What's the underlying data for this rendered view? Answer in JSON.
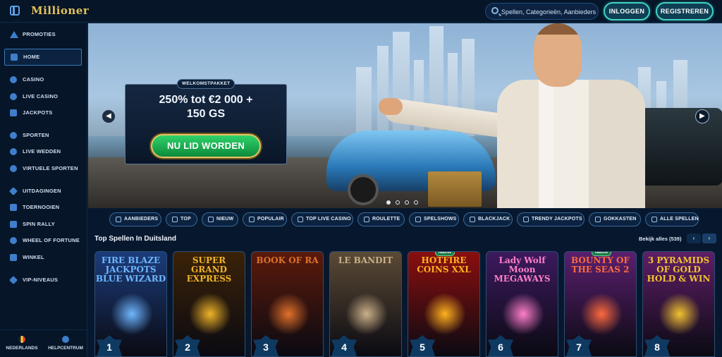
{
  "header": {
    "logo": "Millioner",
    "search_placeholder": "Spellen, Categorieën, Aanbieders",
    "login_label": "INLOGGEN",
    "register_label": "REGISTREREN"
  },
  "sidebar": {
    "items": [
      {
        "label": "PROMOTIES",
        "icon": "megaphone-icon"
      },
      {
        "label": "HOME",
        "icon": "home-icon",
        "active": true
      },
      {
        "label": "CASINO",
        "icon": "spade-icon"
      },
      {
        "label": "LIVE CASINO",
        "icon": "live-spade-icon"
      },
      {
        "label": "JACKPOTS",
        "icon": "jackpot-icon"
      },
      {
        "label": "SPORTEN",
        "icon": "soccer-ball-icon"
      },
      {
        "label": "LIVE WEDDEN",
        "icon": "live-bet-icon"
      },
      {
        "label": "VIRTUELE SPORTEN",
        "icon": "virtual-sports-icon"
      },
      {
        "label": "UITDAGINGEN",
        "icon": "challenges-icon"
      },
      {
        "label": "TOERNOOIEN",
        "icon": "trophy-icon"
      },
      {
        "label": "SPIN RALLY",
        "icon": "spin-rally-icon"
      },
      {
        "label": "WHEEL OF FORTUNE",
        "icon": "wheel-icon"
      },
      {
        "label": "WINKEL",
        "icon": "shop-basket-icon"
      },
      {
        "label": "VIP-NIVEAUS",
        "icon": "diamond-icon"
      }
    ],
    "footer": {
      "language": "NEDERLANDS",
      "help": "HELPCENTRUM"
    }
  },
  "hero": {
    "tag": "WELKOMSTPAKKET",
    "title_line1": "250% tot €2 000 +",
    "title_line2": "150 GS",
    "cta": "NU LID WORDEN",
    "slides": 4,
    "active_slide": 1
  },
  "categories": [
    {
      "label": "AANBIEDERS",
      "icon": "providers-icon"
    },
    {
      "label": "TOP",
      "icon": "crown-icon"
    },
    {
      "label": "NIEUW",
      "icon": "lightning-icon"
    },
    {
      "label": "POPULAIR",
      "icon": "flame-icon"
    },
    {
      "label": "TOP LIVE CASINO",
      "icon": "star-icon"
    },
    {
      "label": "ROULETTE",
      "icon": "roulette-icon"
    },
    {
      "label": "SPELSHOWS",
      "icon": "microphone-icon"
    },
    {
      "label": "BLACKJACK",
      "icon": "cards-icon"
    },
    {
      "label": "TRENDY JACKPOTS",
      "icon": "trend-icon"
    },
    {
      "label": "GOKKASTEN",
      "icon": "slot-machine-icon"
    },
    {
      "label": "ALLE SPELLEN",
      "icon": "all-games-icon"
    }
  ],
  "games": {
    "title": "Top Spellen In Duitsland",
    "see_all": "Bekijk alles (539)",
    "tiles": [
      {
        "rank": "1",
        "name": "FIRE BLAZE JACKPOTS BLUE WIZARD",
        "bg": "#1b3c7a",
        "accent": "#6fb6ff",
        "new": false
      },
      {
        "rank": "2",
        "name": "SUPER GRAND EXPRESS",
        "bg": "#3a2208",
        "accent": "#f0b429",
        "new": false
      },
      {
        "rank": "3",
        "name": "BOOK OF RA",
        "bg": "#5a1a0c",
        "accent": "#e0712a",
        "new": false
      },
      {
        "rank": "4",
        "name": "LE BANDIT",
        "bg": "#5b4a35",
        "accent": "#cbb08a",
        "new": false
      },
      {
        "rank": "5",
        "name": "HOTFIRE COINS XXL",
        "bg": "#8a0f0f",
        "accent": "#ffb21e",
        "new": true,
        "new_label": "NIEUW"
      },
      {
        "rank": "6",
        "name": "Lady Wolf Moon MEGAWAYS",
        "bg": "#3c1a5e",
        "accent": "#ff7fc8",
        "new": false
      },
      {
        "rank": "7",
        "name": "BOUNTY OF THE SEAS 2",
        "bg": "#5a1f6e",
        "accent": "#ff6a3d",
        "new": true,
        "new_label": "NIEUW"
      },
      {
        "rank": "8",
        "name": "3 PYRAMIDS OF GOLD HOLD & WIN",
        "bg": "#5e1e66",
        "accent": "#f2c230",
        "new": false
      }
    ]
  },
  "colors": {
    "background": "#07182e",
    "accent_teal": "#3fd3c2",
    "cta_green": "#1fb157",
    "gold": "#e3c25d"
  }
}
